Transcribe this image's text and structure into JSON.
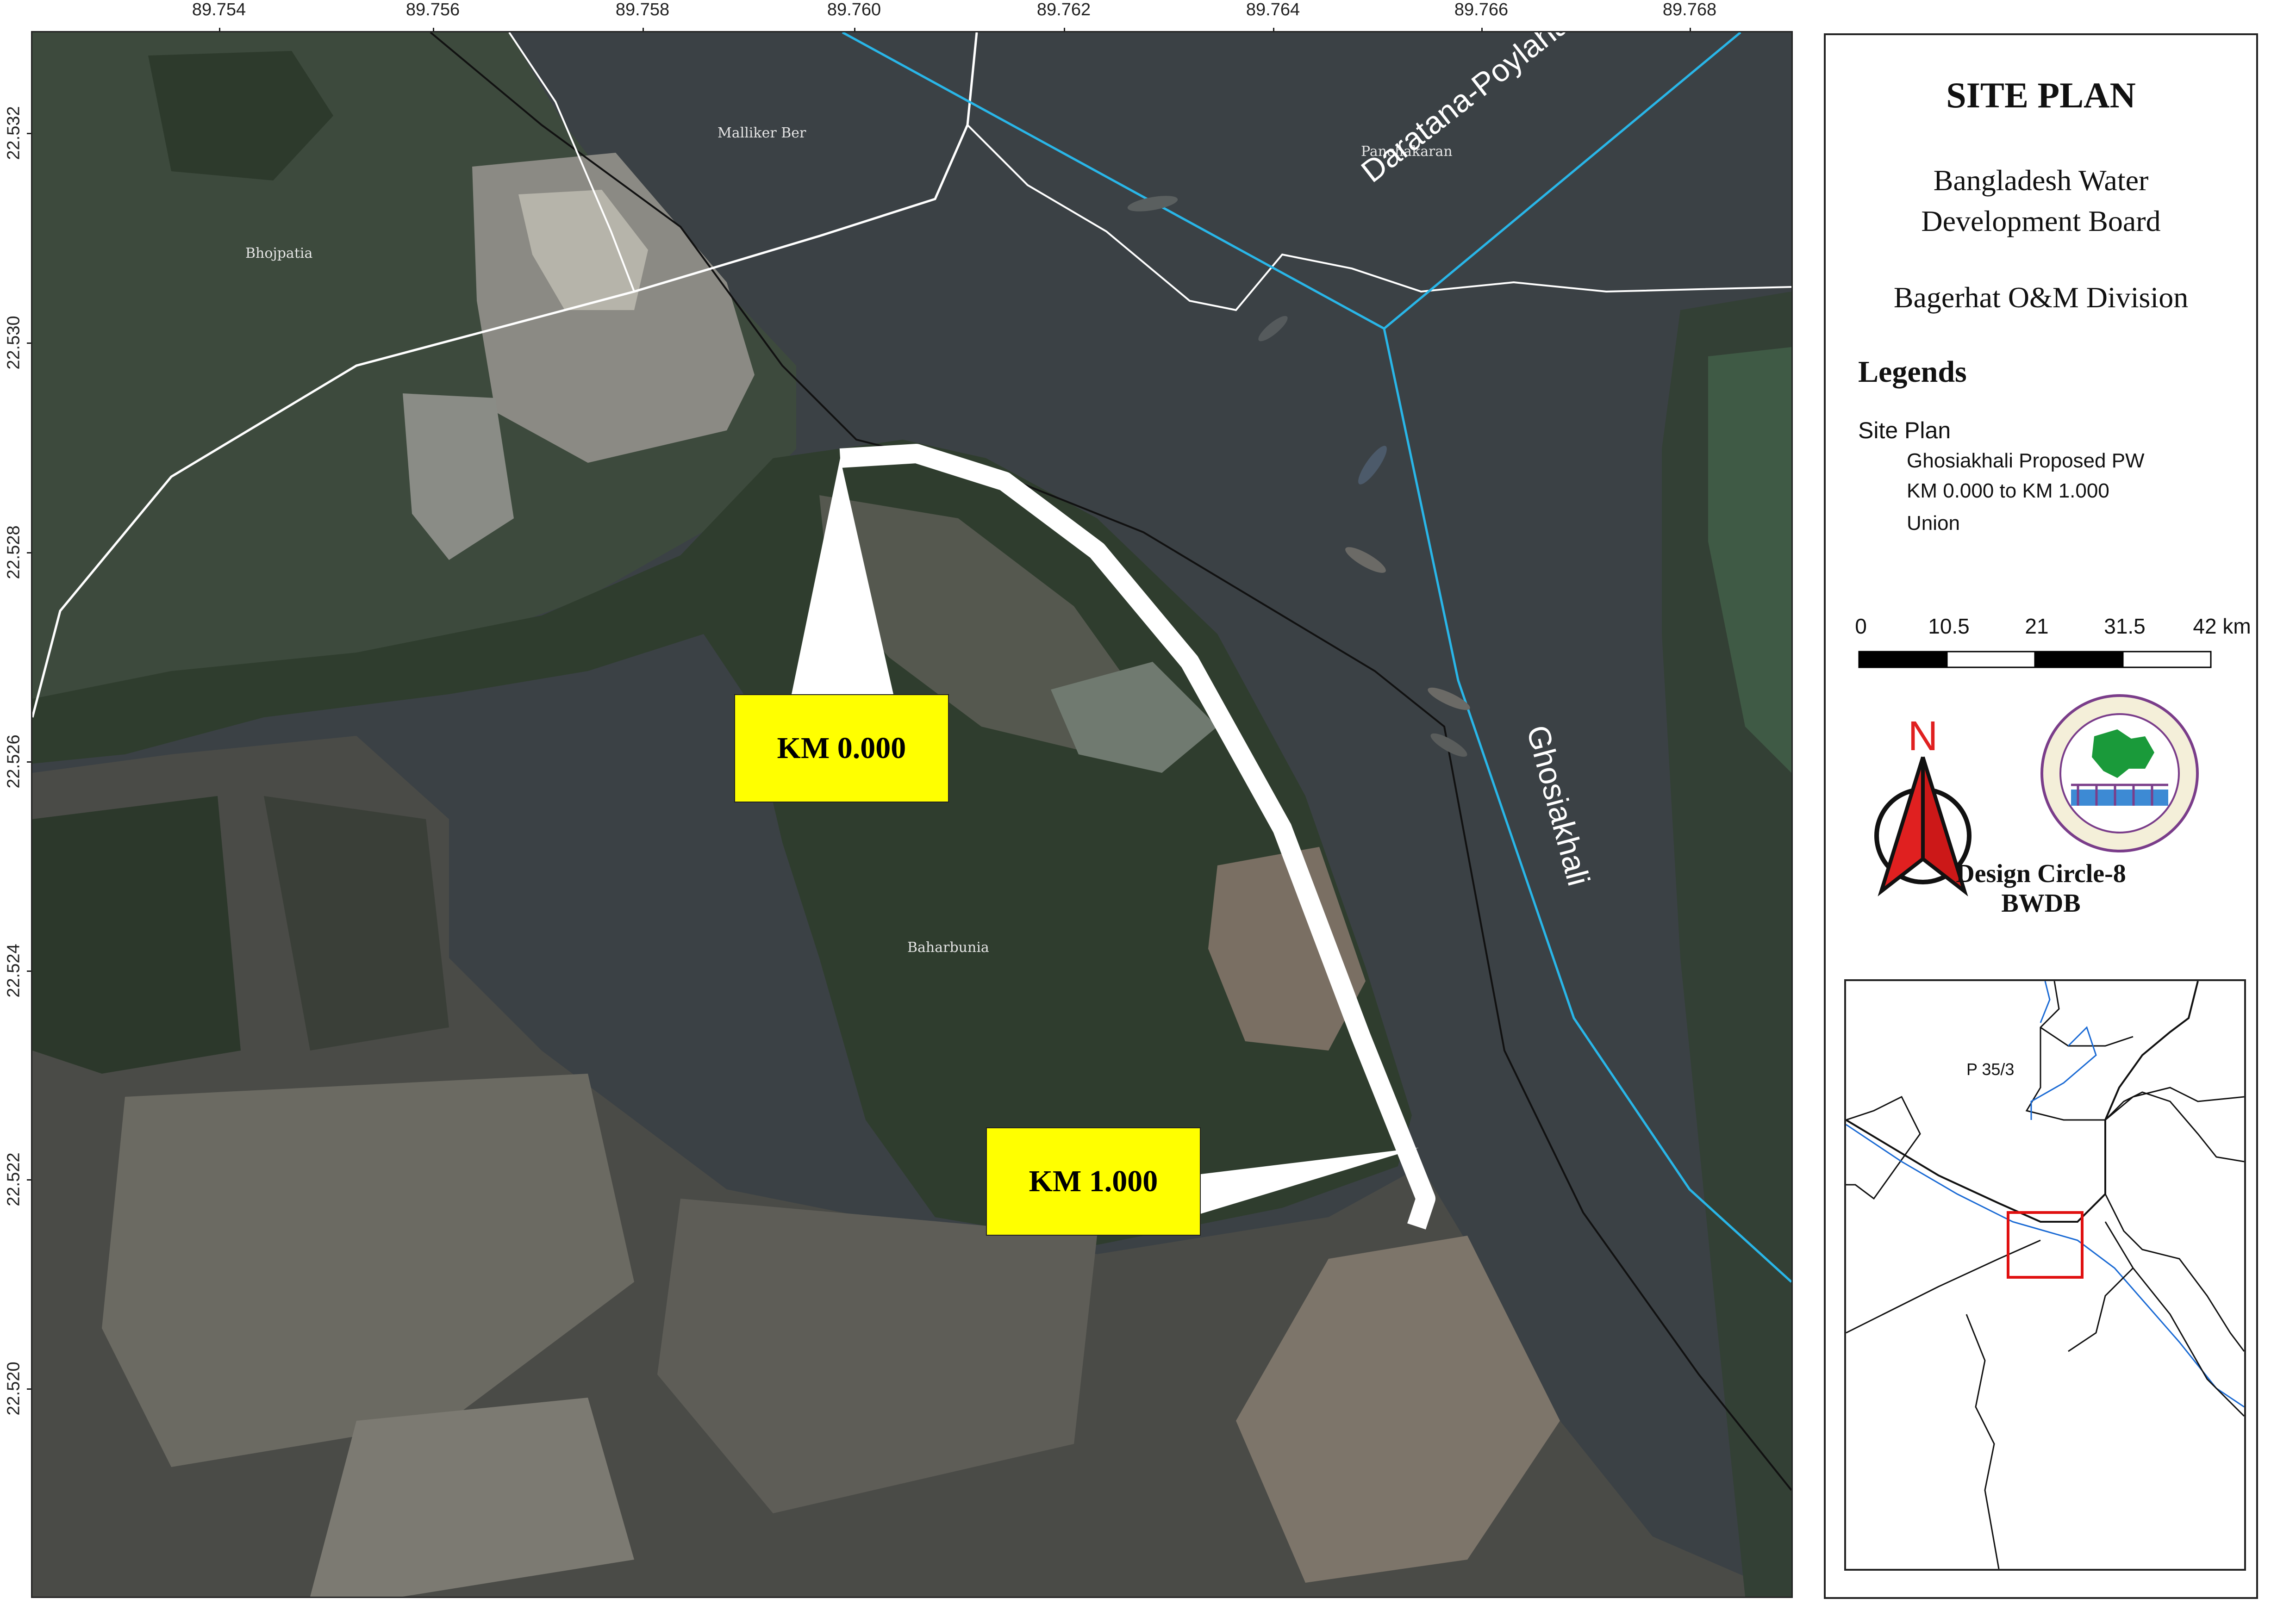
{
  "map": {
    "top_ticks": [
      "89.754",
      "89.756",
      "89.758",
      "89.760",
      "89.762",
      "89.764",
      "89.766",
      "89.768"
    ],
    "left_ticks": [
      "22.532",
      "22.530",
      "22.528",
      "22.526",
      "22.524",
      "22.522",
      "22.520"
    ],
    "places": {
      "malliker_ber": "Malliker Ber",
      "panchakaran": "Panchakaran",
      "bhojpatia": "Bhojpatia",
      "baharbunia": "Baharbunia"
    },
    "rivers": {
      "daratana": "Daratana-Poylahara",
      "ghosiakhali": "Ghosiakhali"
    },
    "km_start": "KM 0.000",
    "km_end": "KM 1.000",
    "colors": {
      "river_line": "#29b6e8",
      "embankment": "#ffffff",
      "label_fill": "#ffff00"
    }
  },
  "panel": {
    "title": "SITE PLAN",
    "org_line1": "Bangladesh Water",
    "org_line2": "Development Board",
    "division": "Bagerhat O&M Division",
    "legends_heading": "Legends",
    "legend_site_plan": "Site Plan",
    "legend_pw_line1": "Ghosiakhali Proposed PW",
    "legend_pw_line2": "KM 0.000 to KM 1.000",
    "legend_union": "Union",
    "scale_labels": [
      "0",
      "10.5",
      "21",
      "31.5",
      "42 km"
    ],
    "north_label": "N",
    "design_line1": "Design Circle-8",
    "design_line2": "BWDB",
    "inset_label": "P 35/3"
  }
}
